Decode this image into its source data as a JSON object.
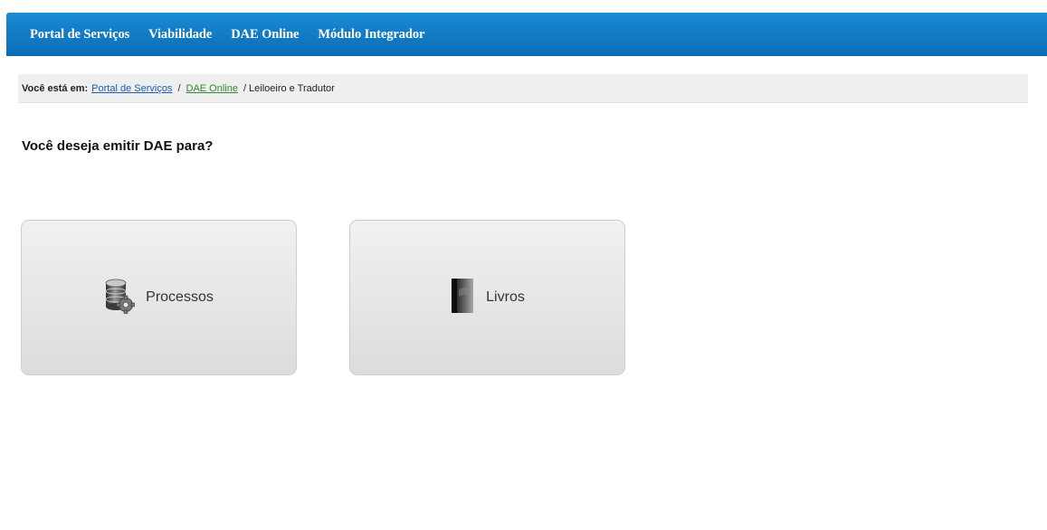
{
  "nav": {
    "items": [
      "Portal de Serviços",
      "Viabilidade",
      "DAE Online",
      "Módulo Integrador"
    ]
  },
  "breadcrumb": {
    "lead": "Você está em:",
    "links": [
      "Portal de Serviços",
      "DAE Online"
    ],
    "separator": "/",
    "current": "Leiloeiro e Tradutor"
  },
  "question": "Você deseja emitir DAE para?",
  "options": [
    {
      "label": "Processos",
      "icon": "database-gear-icon"
    },
    {
      "label": "Livros",
      "icon": "book-icon"
    }
  ],
  "colors": {
    "nav_background": "#0a7bc9",
    "link": "#1a5cae",
    "link_active": "#2e8a2e",
    "breadcrumb_bg": "#efefef"
  }
}
